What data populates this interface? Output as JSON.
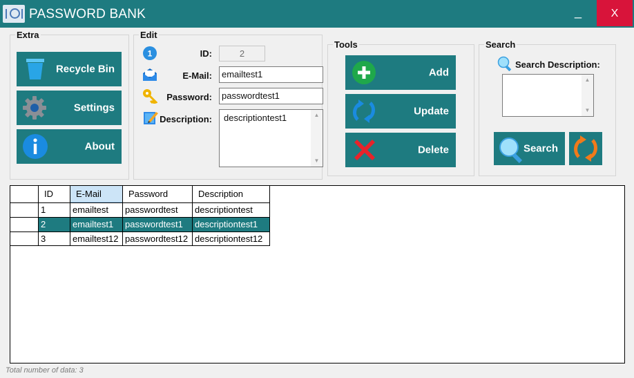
{
  "window": {
    "title": "PASSWORD BANK",
    "minimize_label": "_",
    "close_label": "X"
  },
  "extra": {
    "title": "Extra",
    "buttons": {
      "recycle_bin": "Recycle Bin",
      "settings": "Settings",
      "about": "About"
    }
  },
  "edit": {
    "title": "Edit",
    "id_label": "ID:",
    "id_value": "2",
    "email_label": "E-Mail:",
    "email_value": "emailtest1",
    "password_label": "Password:",
    "password_value": "passwordtest1",
    "description_label": "Description:",
    "description_value": "descriptiontest1"
  },
  "tools": {
    "title": "Tools",
    "buttons": {
      "add": "Add",
      "update": "Update",
      "delete": "Delete"
    }
  },
  "search": {
    "title": "Search",
    "description_label": "Search Description:",
    "description_value": "",
    "search_button": "Search"
  },
  "grid": {
    "columns": [
      "ID",
      "E-Mail",
      "Password",
      "Description"
    ],
    "rows": [
      [
        "1",
        "emailtest",
        "passwordtest",
        "descriptiontest"
      ],
      [
        "2",
        "emailtest1",
        "passwordtest1",
        "descriptiontest1"
      ],
      [
        "3",
        "emailtest12",
        "passwordtest12",
        "descriptiontest12"
      ]
    ],
    "selected_row": 1,
    "selected_column": 1
  },
  "footer": {
    "total_text": "Total number of data: 3"
  },
  "colors": {
    "primary": "#1e7b80",
    "close": "#d8143a",
    "selection": "#1e7b80",
    "header_highlight": "#cce4f7"
  },
  "icons": [
    "recycle-bin-icon",
    "settings-gear-icon",
    "info-icon",
    "id-badge-icon",
    "email-envelope-icon",
    "key-icon",
    "pencil-note-icon",
    "add-plus-icon",
    "update-refresh-icon",
    "delete-x-icon",
    "magnifier-icon",
    "refresh-icon"
  ]
}
